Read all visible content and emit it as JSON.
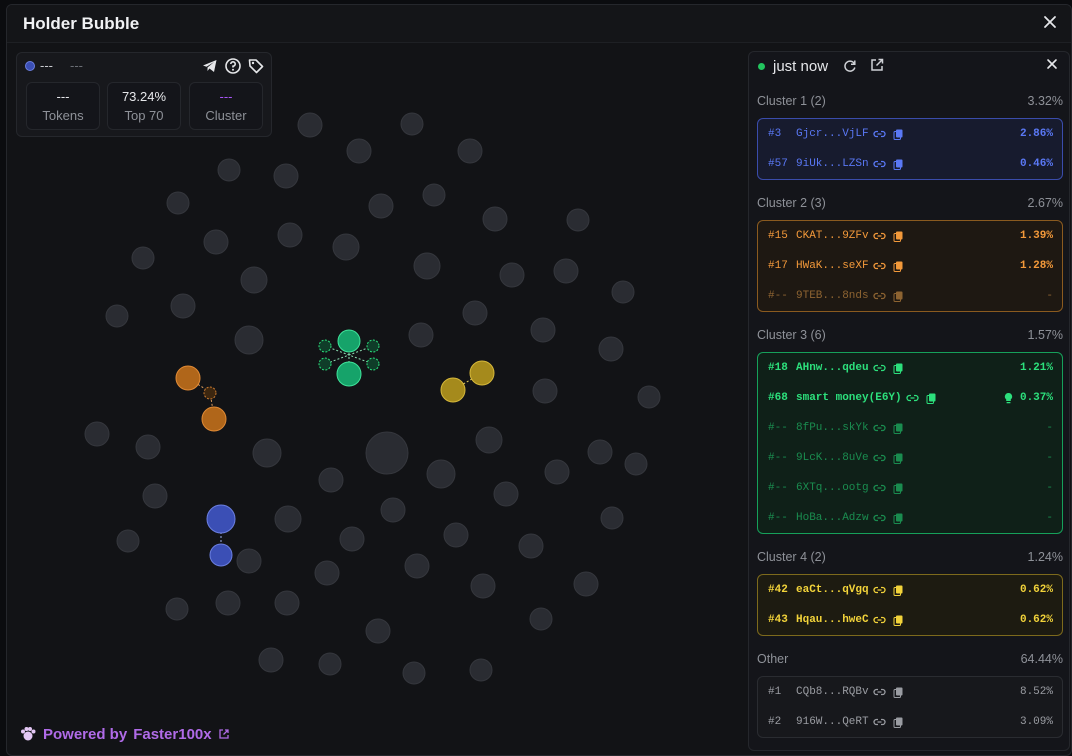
{
  "title": "Holder Bubble",
  "stats": {
    "indicator_label": "---",
    "indicator_sub": "---",
    "tokens_value": "---",
    "tokens_label": "Tokens",
    "top_value": "73.24%",
    "top_label": "Top 70",
    "cluster_value": "---",
    "cluster_label": "Cluster"
  },
  "powered_by": {
    "prefix": "Powered by",
    "brand": "Faster100x"
  },
  "panel": {
    "status": "just now",
    "clusters": [
      {
        "name": "Cluster 1 (2)",
        "pct": "3.32%",
        "color": "#5a78f5",
        "rows": [
          {
            "rank": "#3",
            "addr": "Gjcr...VjLF",
            "val": "2.86%"
          },
          {
            "rank": "#57",
            "addr": "9iUk...LZSn",
            "val": "0.46%"
          }
        ]
      },
      {
        "name": "Cluster 2 (3)",
        "pct": "2.67%",
        "color": "#f3993a",
        "rows": [
          {
            "rank": "#15",
            "addr": "CKAT...9ZFv",
            "val": "1.39%"
          },
          {
            "rank": "#17",
            "addr": "HWaK...seXF",
            "val": "1.28%"
          },
          {
            "rank": "#--",
            "addr": "9TEB...8nds",
            "val": "-"
          }
        ]
      },
      {
        "name": "Cluster 3 (6)",
        "pct": "1.57%",
        "color": "#2ce07c",
        "rows": [
          {
            "rank": "#18",
            "addr": "AHnw...qdeu",
            "val": "1.21%"
          },
          {
            "rank": "#68",
            "addr": "smart money(E6Y)",
            "val": "0.37%"
          },
          {
            "rank": "#--",
            "addr": "8fPu...skYk",
            "val": "-"
          },
          {
            "rank": "#--",
            "addr": "9LcK...8uVe",
            "val": "-"
          },
          {
            "rank": "#--",
            "addr": "6XTq...ootg",
            "val": "-"
          },
          {
            "rank": "#--",
            "addr": "HoBa...Adzw",
            "val": "-"
          }
        ]
      },
      {
        "name": "Cluster 4 (2)",
        "pct": "1.24%",
        "color": "#f2d33a",
        "rows": [
          {
            "rank": "#42",
            "addr": "eaCt...qVgq",
            "val": "0.62%"
          },
          {
            "rank": "#43",
            "addr": "Hqau...hweC",
            "val": "0.62%"
          }
        ]
      },
      {
        "name": "Other",
        "pct": "64.44%",
        "color": "#9a9ca2",
        "rows": [
          {
            "rank": "#1",
            "addr": "CQb8...RQBv",
            "val": "8.52%"
          },
          {
            "rank": "#2",
            "addr": "916W...QeRT",
            "val": "3.09%"
          }
        ]
      }
    ]
  },
  "colors": {
    "bubble_gray": "#2a2c32",
    "cluster_blue": "#3b4fb5",
    "cluster_orange": "#b0661a",
    "cluster_green": "#16a36a",
    "cluster_yellow": "#a58a1c"
  },
  "icons": {
    "indicator": "dot-icon",
    "telegram": "telegram-icon",
    "help": "help-icon",
    "tag": "tag-icon",
    "refresh": "refresh-icon",
    "external": "external-link-icon",
    "link": "link-icon",
    "copy": "copy-icon",
    "smart": "bulb-icon"
  }
}
